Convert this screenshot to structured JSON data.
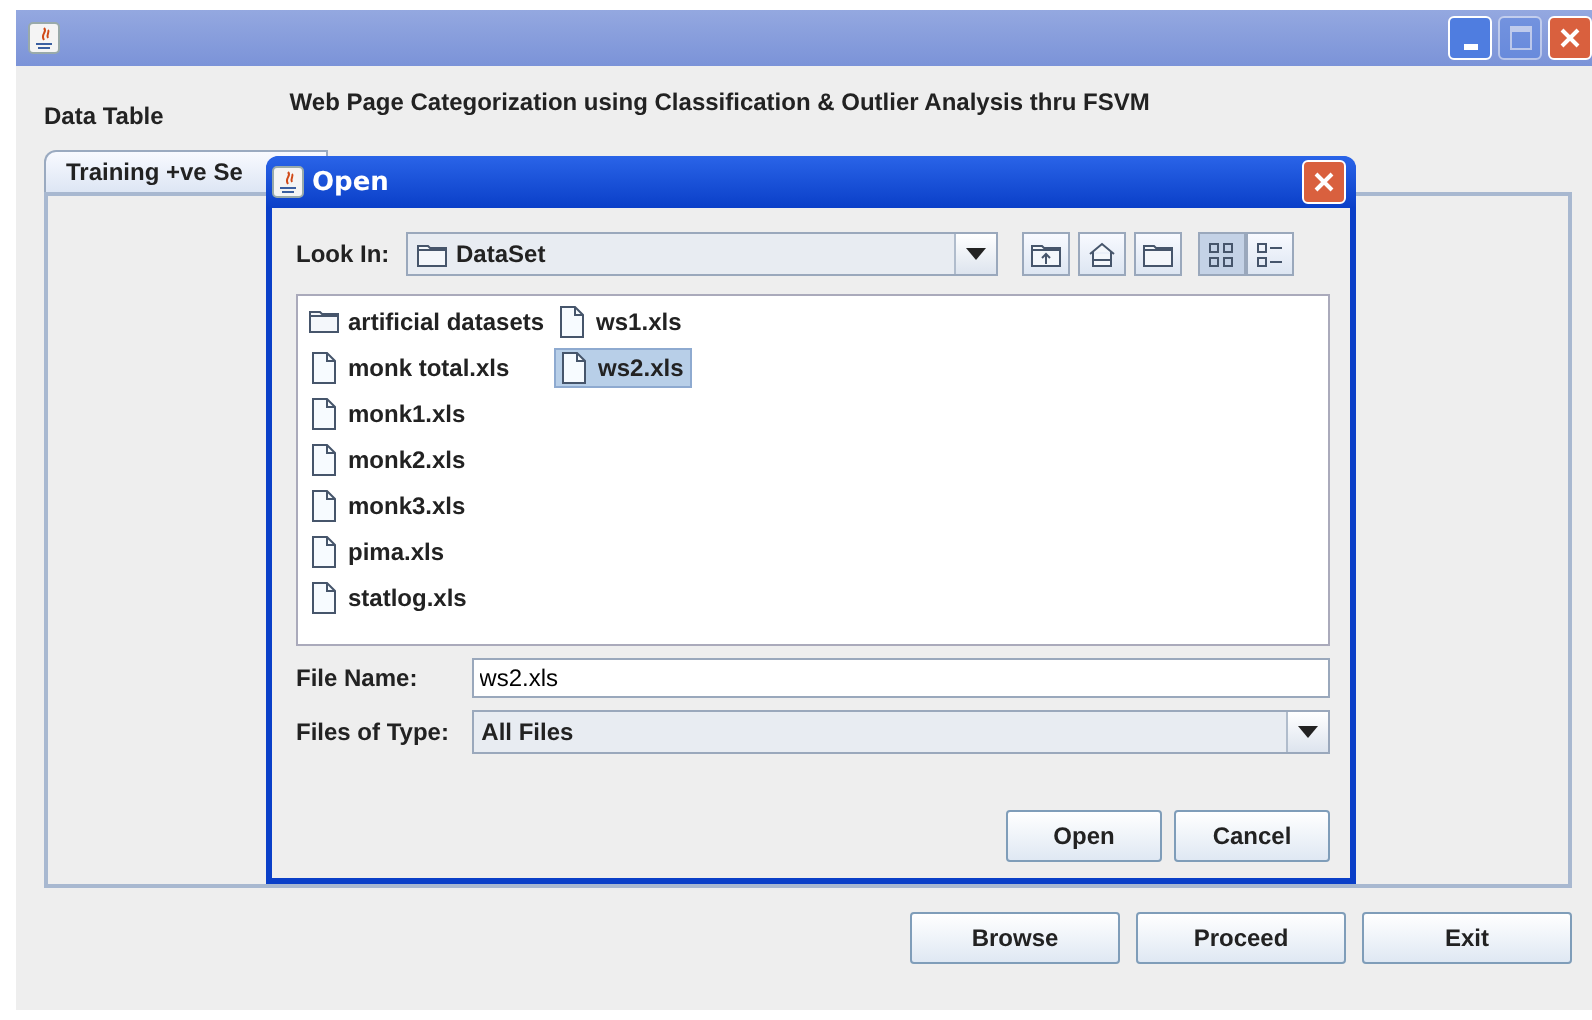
{
  "window": {
    "maximize_disabled": true
  },
  "header": {
    "title": "Web Page Categorization using Classification & Outlier Analysis thru FSVM",
    "section": "Data Table"
  },
  "tabs": [
    {
      "label": "Training +ve Se",
      "selected": true
    }
  ],
  "dialog": {
    "title": "Open",
    "look_in": {
      "label": "Look In:",
      "value": "DataSet"
    },
    "view_buttons": [
      {
        "kind": "up"
      },
      {
        "kind": "home"
      },
      {
        "kind": "new-folder"
      },
      {
        "kind": "list",
        "selected": true
      },
      {
        "kind": "details",
        "selected": false
      }
    ],
    "files": [
      {
        "name": "artificial datasets",
        "kind": "folder",
        "selected": false
      },
      {
        "name": "monk total.xls",
        "kind": "file",
        "selected": false
      },
      {
        "name": "monk1.xls",
        "kind": "file",
        "selected": false
      },
      {
        "name": "monk2.xls",
        "kind": "file",
        "selected": false
      },
      {
        "name": "monk3.xls",
        "kind": "file",
        "selected": false
      },
      {
        "name": "pima.xls",
        "kind": "file",
        "selected": false
      },
      {
        "name": "statlog.xls",
        "kind": "file",
        "selected": false
      },
      {
        "name": "ws1.xls",
        "kind": "file",
        "selected": false
      },
      {
        "name": "ws2.xls",
        "kind": "file",
        "selected": true
      }
    ],
    "file_name": {
      "label": "File Name:",
      "value": "ws2.xls"
    },
    "file_type": {
      "label": "Files of Type:",
      "value": "All Files"
    },
    "buttons": [
      "Open",
      "Cancel"
    ]
  },
  "buttons": [
    "Browse",
    "Proceed",
    "Exit"
  ]
}
